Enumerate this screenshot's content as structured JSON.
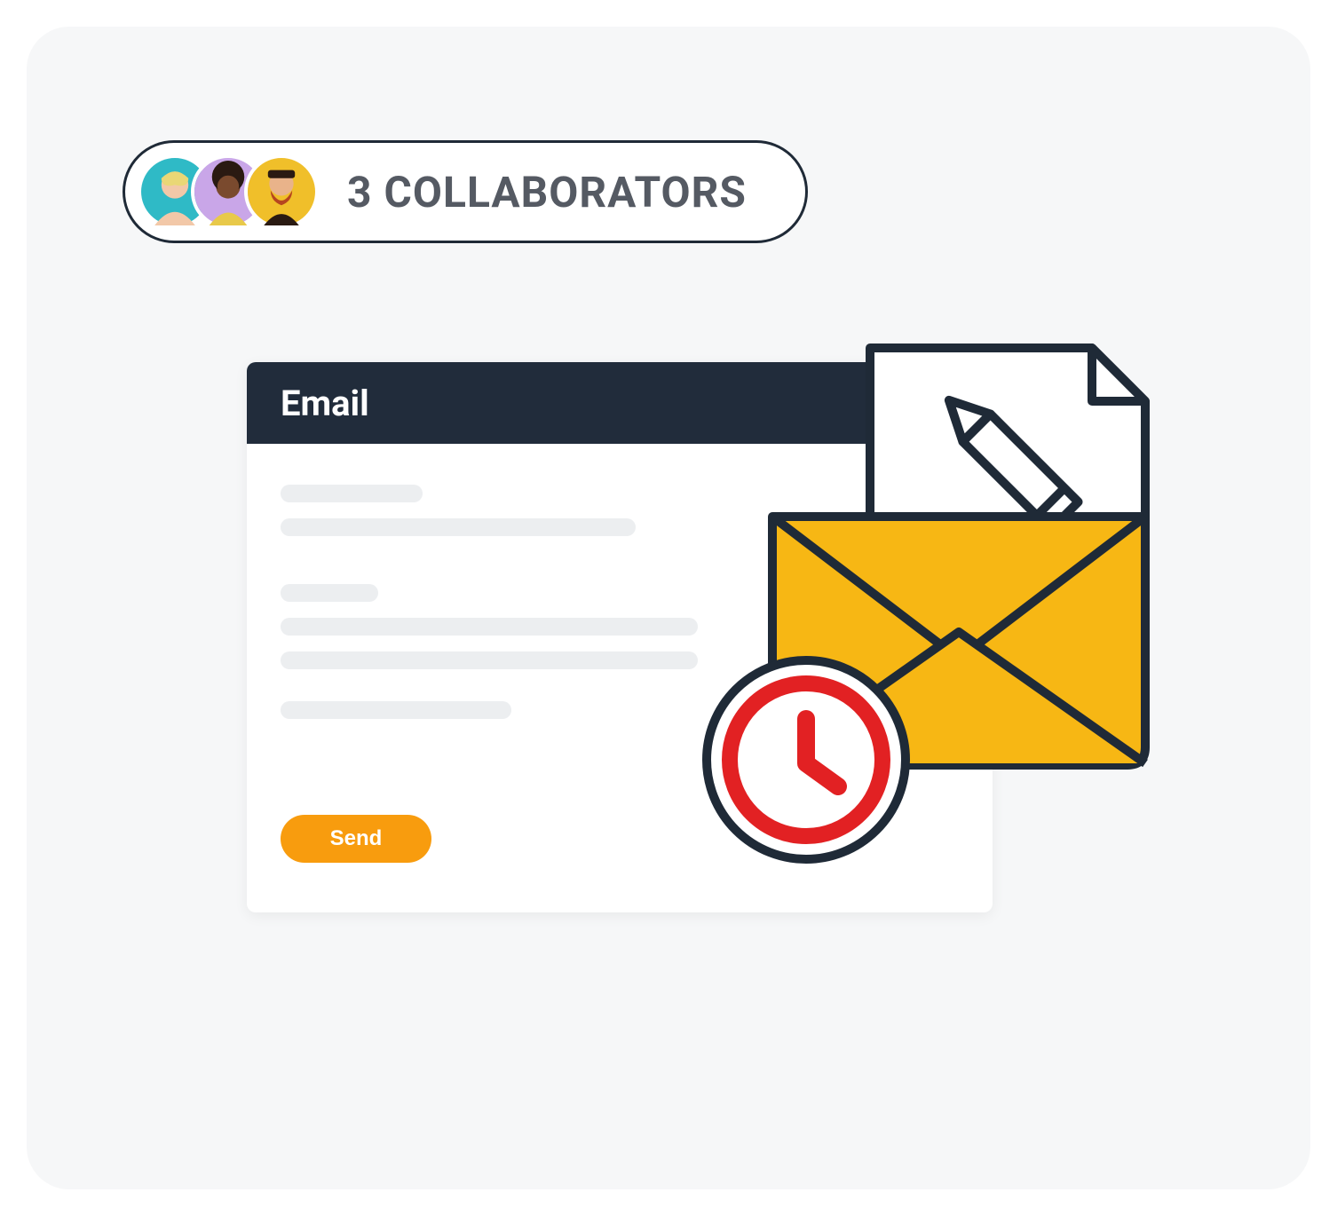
{
  "collaborators": {
    "label": "3 COLLABORATORS",
    "count": 3,
    "avatars": [
      {
        "bg": "#2fbac6",
        "skin": "#f2c8a8",
        "hair": "#e9d776"
      },
      {
        "bg": "#c9a6e8",
        "skin": "#7a4a2e",
        "hair": "#2a1a12"
      },
      {
        "bg": "#f0bf2a",
        "skin": "#e9b38a",
        "hair": "#b6451f"
      }
    ]
  },
  "email": {
    "title": "Email",
    "send_label": "Send"
  },
  "colors": {
    "accent": "#f89c0e",
    "header": "#212c3b",
    "envelope": "#f7b714",
    "clock": "#e22123"
  }
}
